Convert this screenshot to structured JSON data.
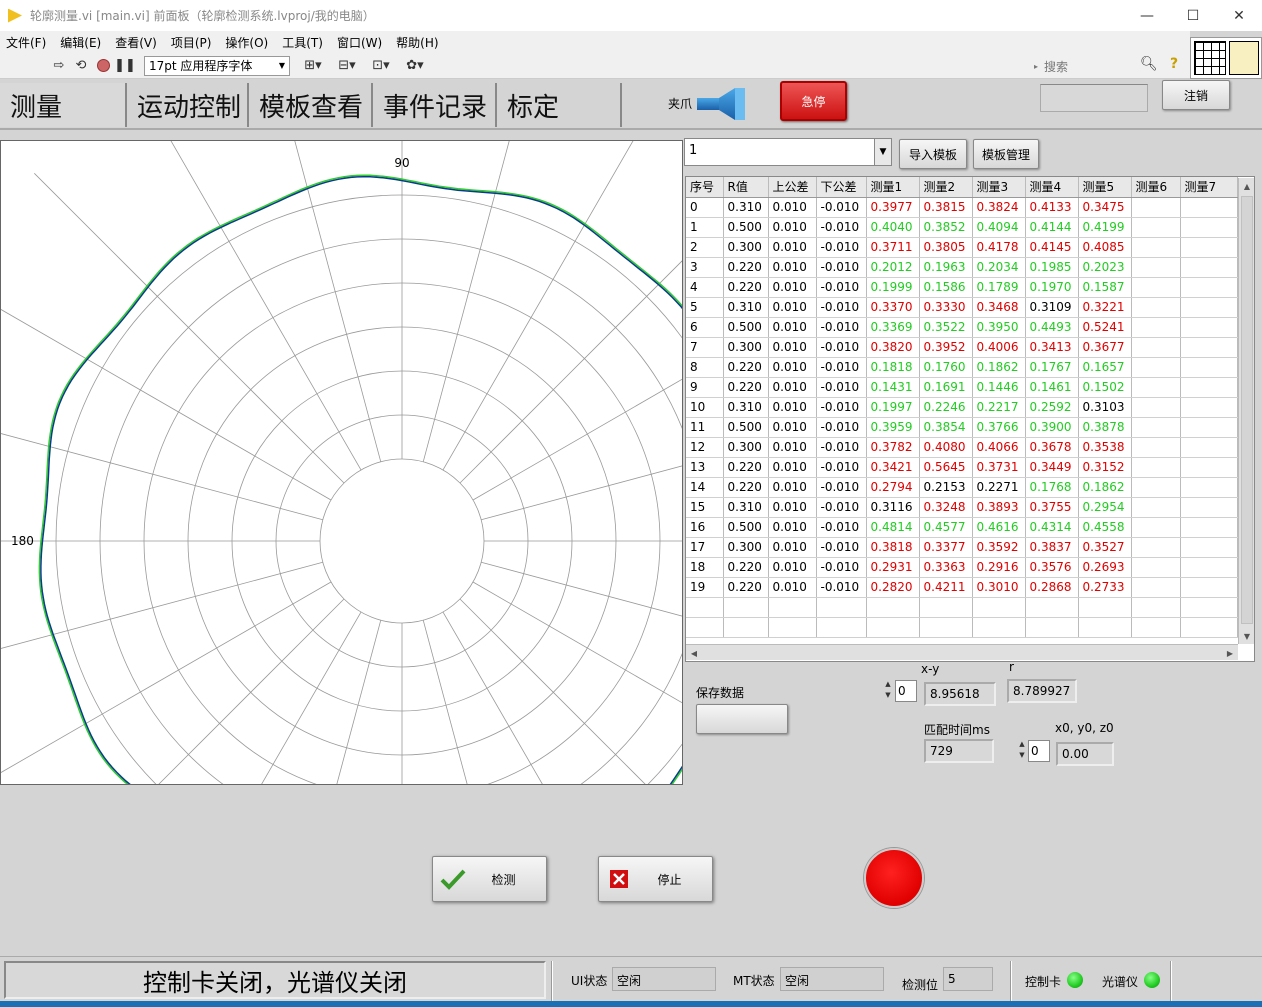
{
  "window": {
    "title": "轮廓测量.vi [main.vi] 前面板（轮廓检测系统.lvproj/我的电脑）",
    "controls": {
      "minimize": "—",
      "maximize": "☐",
      "close": "✕"
    }
  },
  "menu": [
    "文件(F)",
    "编辑(E)",
    "查看(V)",
    "项目(P)",
    "操作(O)",
    "工具(T)",
    "窗口(W)",
    "帮助(H)"
  ],
  "toolbar": {
    "font": "17pt 应用程序字体",
    "search_placeholder": "搜索",
    "icons": [
      "run-arrow-icon",
      "run-continuous-icon",
      "abort-icon",
      "pause-icon",
      "align-icon",
      "distribute-icon",
      "resize-icon",
      "reorder-icon"
    ]
  },
  "tabs": [
    "测量",
    "运动控制",
    "模板查看",
    "事件记录",
    "标定"
  ],
  "header": {
    "gripper_label": "夹爪",
    "estop_label": "急停",
    "logout_label": "注销"
  },
  "polar": {
    "label_90": "90",
    "label_180": "180",
    "colors": {
      "curve": "#0a3a8a",
      "curve2": "#2ecc2e",
      "grid": "#999999"
    }
  },
  "template": {
    "selected": "1",
    "import_label": "导入模板",
    "manage_label": "模板管理"
  },
  "table": {
    "headers": [
      "序号",
      "R值",
      "上公差",
      "下公差",
      "测量1",
      "测量2",
      "测量3",
      "测量4",
      "测量5",
      "测量6",
      "测量7"
    ],
    "rows": [
      {
        "cells": [
          "0",
          "0.310",
          "0.010",
          "-0.010",
          "0.3977",
          "0.3815",
          "0.3824",
          "0.4133",
          "0.3475",
          "",
          ""
        ],
        "colors": [
          "k",
          "k",
          "k",
          "k",
          "r",
          "r",
          "r",
          "r",
          "r"
        ]
      },
      {
        "cells": [
          "1",
          "0.500",
          "0.010",
          "-0.010",
          "0.4040",
          "0.3852",
          "0.4094",
          "0.4144",
          "0.4199",
          "",
          ""
        ],
        "colors": [
          "k",
          "k",
          "k",
          "k",
          "g",
          "g",
          "g",
          "g",
          "g"
        ]
      },
      {
        "cells": [
          "2",
          "0.300",
          "0.010",
          "-0.010",
          "0.3711",
          "0.3805",
          "0.4178",
          "0.4145",
          "0.4085",
          "",
          ""
        ],
        "colors": [
          "k",
          "k",
          "k",
          "k",
          "r",
          "r",
          "r",
          "r",
          "r"
        ]
      },
      {
        "cells": [
          "3",
          "0.220",
          "0.010",
          "-0.010",
          "0.2012",
          "0.1963",
          "0.2034",
          "0.1985",
          "0.2023",
          "",
          ""
        ],
        "colors": [
          "k",
          "k",
          "k",
          "k",
          "g",
          "g",
          "g",
          "g",
          "g"
        ]
      },
      {
        "cells": [
          "4",
          "0.220",
          "0.010",
          "-0.010",
          "0.1999",
          "0.1586",
          "0.1789",
          "0.1970",
          "0.1587",
          "",
          ""
        ],
        "colors": [
          "k",
          "k",
          "k",
          "k",
          "g",
          "g",
          "g",
          "g",
          "g"
        ]
      },
      {
        "cells": [
          "5",
          "0.310",
          "0.010",
          "-0.010",
          "0.3370",
          "0.3330",
          "0.3468",
          "0.3109",
          "0.3221",
          "",
          ""
        ],
        "colors": [
          "k",
          "k",
          "k",
          "k",
          "r",
          "r",
          "r",
          "k",
          "r"
        ]
      },
      {
        "cells": [
          "6",
          "0.500",
          "0.010",
          "-0.010",
          "0.3369",
          "0.3522",
          "0.3950",
          "0.4493",
          "0.5241",
          "",
          ""
        ],
        "colors": [
          "k",
          "k",
          "k",
          "k",
          "g",
          "g",
          "g",
          "g",
          "r"
        ]
      },
      {
        "cells": [
          "7",
          "0.300",
          "0.010",
          "-0.010",
          "0.3820",
          "0.3952",
          "0.4006",
          "0.3413",
          "0.3677",
          "",
          ""
        ],
        "colors": [
          "k",
          "k",
          "k",
          "k",
          "r",
          "r",
          "r",
          "r",
          "r"
        ]
      },
      {
        "cells": [
          "8",
          "0.220",
          "0.010",
          "-0.010",
          "0.1818",
          "0.1760",
          "0.1862",
          "0.1767",
          "0.1657",
          "",
          ""
        ],
        "colors": [
          "k",
          "k",
          "k",
          "k",
          "g",
          "g",
          "g",
          "g",
          "g"
        ]
      },
      {
        "cells": [
          "9",
          "0.220",
          "0.010",
          "-0.010",
          "0.1431",
          "0.1691",
          "0.1446",
          "0.1461",
          "0.1502",
          "",
          ""
        ],
        "colors": [
          "k",
          "k",
          "k",
          "k",
          "g",
          "g",
          "g",
          "g",
          "g"
        ]
      },
      {
        "cells": [
          "10",
          "0.310",
          "0.010",
          "-0.010",
          "0.1997",
          "0.2246",
          "0.2217",
          "0.2592",
          "0.3103",
          "",
          ""
        ],
        "colors": [
          "k",
          "k",
          "k",
          "k",
          "g",
          "g",
          "g",
          "g",
          "k"
        ]
      },
      {
        "cells": [
          "11",
          "0.500",
          "0.010",
          "-0.010",
          "0.3959",
          "0.3854",
          "0.3766",
          "0.3900",
          "0.3878",
          "",
          ""
        ],
        "colors": [
          "k",
          "k",
          "k",
          "k",
          "g",
          "g",
          "g",
          "g",
          "g"
        ]
      },
      {
        "cells": [
          "12",
          "0.300",
          "0.010",
          "-0.010",
          "0.3782",
          "0.4080",
          "0.4066",
          "0.3678",
          "0.3538",
          "",
          ""
        ],
        "colors": [
          "k",
          "k",
          "k",
          "k",
          "r",
          "r",
          "r",
          "r",
          "r"
        ]
      },
      {
        "cells": [
          "13",
          "0.220",
          "0.010",
          "-0.010",
          "0.3421",
          "0.5645",
          "0.3731",
          "0.3449",
          "0.3152",
          "",
          ""
        ],
        "colors": [
          "k",
          "k",
          "k",
          "k",
          "r",
          "r",
          "r",
          "r",
          "r"
        ]
      },
      {
        "cells": [
          "14",
          "0.220",
          "0.010",
          "-0.010",
          "0.2794",
          "0.2153",
          "0.2271",
          "0.1768",
          "0.1862",
          "",
          ""
        ],
        "colors": [
          "k",
          "k",
          "k",
          "k",
          "r",
          "k",
          "k",
          "g",
          "g"
        ]
      },
      {
        "cells": [
          "15",
          "0.310",
          "0.010",
          "-0.010",
          "0.3116",
          "0.3248",
          "0.3893",
          "0.3755",
          "0.2954",
          "",
          ""
        ],
        "colors": [
          "k",
          "k",
          "k",
          "k",
          "k",
          "r",
          "r",
          "r",
          "g"
        ]
      },
      {
        "cells": [
          "16",
          "0.500",
          "0.010",
          "-0.010",
          "0.4814",
          "0.4577",
          "0.4616",
          "0.4314",
          "0.4558",
          "",
          ""
        ],
        "colors": [
          "k",
          "k",
          "k",
          "k",
          "g",
          "g",
          "g",
          "g",
          "g"
        ]
      },
      {
        "cells": [
          "17",
          "0.300",
          "0.010",
          "-0.010",
          "0.3818",
          "0.3377",
          "0.3592",
          "0.3837",
          "0.3527",
          "",
          ""
        ],
        "colors": [
          "k",
          "k",
          "k",
          "k",
          "r",
          "r",
          "r",
          "r",
          "r"
        ]
      },
      {
        "cells": [
          "18",
          "0.220",
          "0.010",
          "-0.010",
          "0.2931",
          "0.3363",
          "0.2916",
          "0.3576",
          "0.2693",
          "",
          ""
        ],
        "colors": [
          "k",
          "k",
          "k",
          "k",
          "r",
          "r",
          "r",
          "r",
          "r"
        ]
      },
      {
        "cells": [
          "19",
          "0.220",
          "0.010",
          "-0.010",
          "0.2820",
          "0.4211",
          "0.3010",
          "0.2868",
          "0.2733",
          "",
          ""
        ],
        "colors": [
          "k",
          "k",
          "k",
          "k",
          "r",
          "r",
          "r",
          "r",
          "r"
        ]
      }
    ],
    "blank_rows": 2
  },
  "readouts": {
    "save_label": "保存数据",
    "xy_label": "x-y",
    "xy_index": "0",
    "xy_value": "8.95618",
    "r_label": "r",
    "r_value": "8.789927",
    "match_time_label": "匹配时间ms",
    "match_time_value": "729",
    "xyz_label": "x0, y0, z0",
    "xyz_index": "0",
    "xyz_value": "0.00"
  },
  "actions": {
    "detect_label": "检测",
    "stop_label": "停止",
    "led_color": "#ff0000"
  },
  "status": {
    "message": "控制卡关闭，光谱仪关闭",
    "ui_label": "UI状态",
    "ui_value": "空闲",
    "mt_label": "MT状态",
    "mt_value": "空闲",
    "pos_label": "检测位",
    "pos_value": "5",
    "card_label": "控制卡",
    "spectro_label": "光谱仪",
    "led_on_color": "#22cc22"
  }
}
